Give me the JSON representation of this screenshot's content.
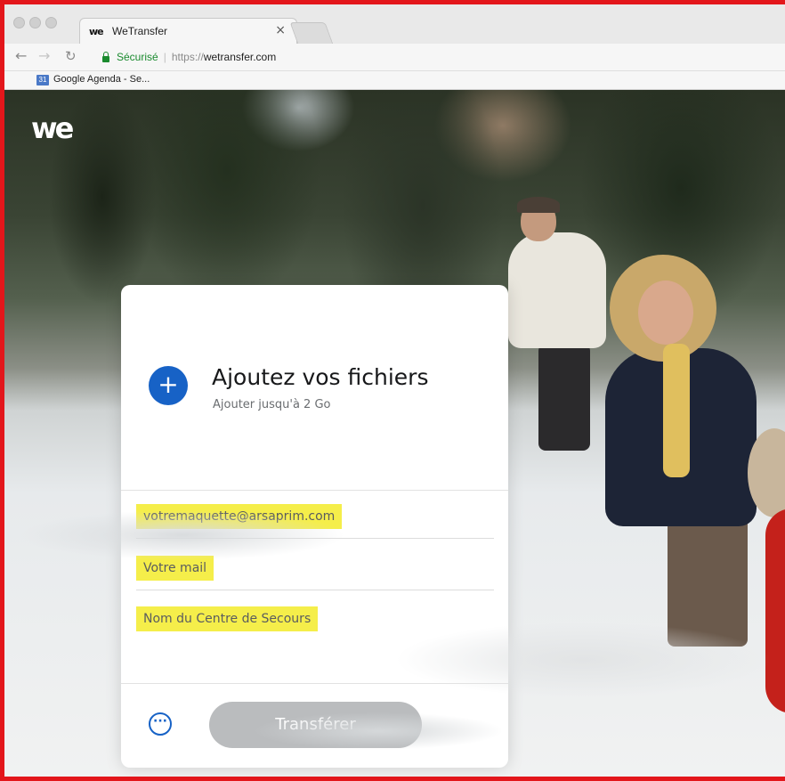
{
  "browser": {
    "tab_title": "WeTransfer",
    "tab_favicon": "we",
    "tab_close": "×",
    "address": {
      "secure_label": "Sécurisé",
      "scheme": "https://",
      "host": "wetransfer.com"
    },
    "bookmark_label": "Google Agenda - Se...",
    "bookmark_icon_text": "31"
  },
  "page": {
    "logo": "we",
    "upload": {
      "icon": "+",
      "title": "Ajoutez vos fichiers",
      "subtitle": "Ajouter jusqu'à 2 Go"
    },
    "fields": {
      "to_value": "votremaquette@arsaprim.com",
      "from_value": "Votre mail",
      "message_value": "Nom du Centre de Secours"
    },
    "more_options_icon": "···",
    "transfer_label": "Transférer"
  },
  "colors": {
    "frame_border": "#e3161b",
    "accent_blue": "#1762c6",
    "highlight_yellow": "#f5ee4a",
    "button_disabled": "#babcbe"
  },
  "icons": [
    "close-icon",
    "back-arrow-icon",
    "forward-arrow-icon",
    "reload-icon",
    "lock-icon",
    "calendar-icon",
    "plus-icon",
    "more-options-icon"
  ]
}
